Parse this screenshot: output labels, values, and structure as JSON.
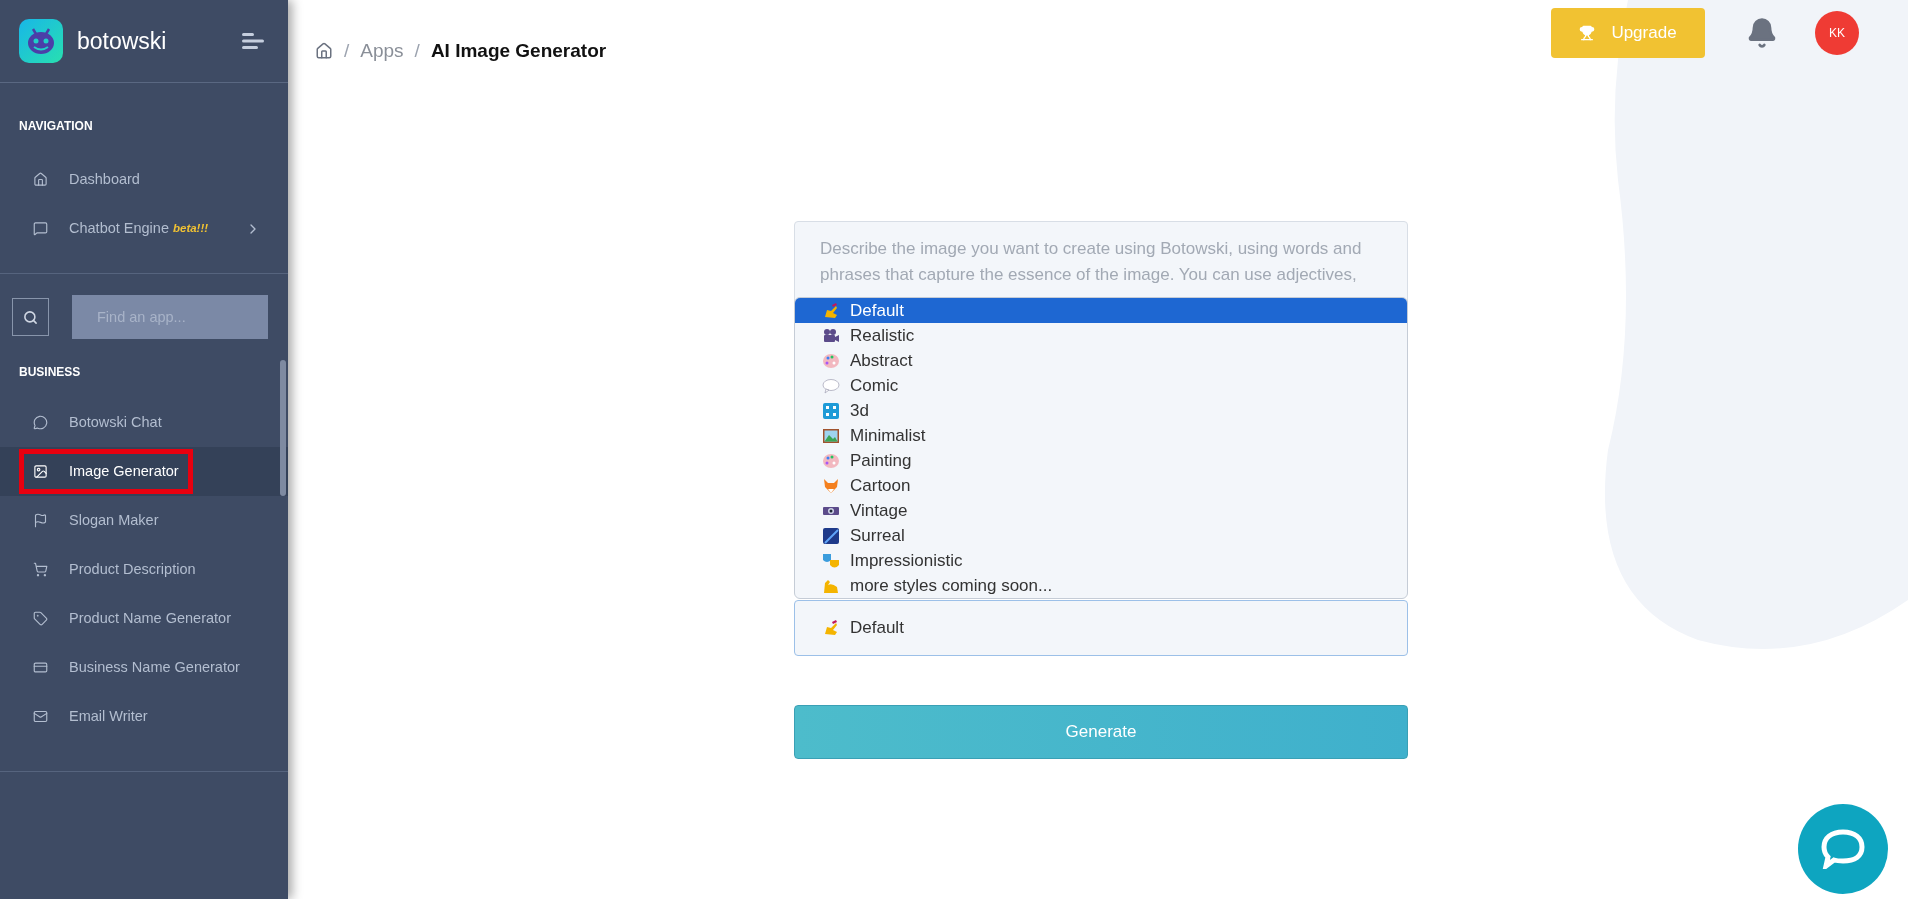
{
  "brand": {
    "name": "botowski"
  },
  "sidebar": {
    "sections": [
      {
        "title": "NAVIGATION",
        "items": [
          {
            "label": "Dashboard",
            "selected": false
          },
          {
            "label": "Chatbot Engine",
            "badge": "beta!!!",
            "submenu": true,
            "selected": false
          }
        ]
      },
      {
        "title": "BUSINESS",
        "items": [
          {
            "label": "Botowski Chat",
            "selected": false
          },
          {
            "label": "Image Generator",
            "selected": true,
            "highlighted": true
          },
          {
            "label": "Slogan Maker",
            "selected": false
          },
          {
            "label": "Product Description",
            "selected": false
          },
          {
            "label": "Product Name Generator",
            "selected": false
          },
          {
            "label": "Business Name Generator",
            "selected": false
          },
          {
            "label": "Email Writer",
            "selected": false
          }
        ]
      }
    ],
    "search": {
      "placeholder": "Find an app..."
    }
  },
  "breadcrumb": {
    "separator": "/",
    "items": [
      "Apps",
      "AI Image Generator"
    ]
  },
  "header": {
    "upgrade": "Upgrade",
    "avatar": "KK"
  },
  "form": {
    "prompt_placeholder": "Describe the image you want to create using Botowski, using words and phrases that capture the essence of the image. You can use adjectives,",
    "style_options": [
      {
        "label": "Default",
        "selected": true
      },
      {
        "label": "Realistic",
        "selected": false
      },
      {
        "label": "Abstract",
        "selected": false
      },
      {
        "label": "Comic",
        "selected": false
      },
      {
        "label": "3d",
        "selected": false
      },
      {
        "label": "Minimalist",
        "selected": false
      },
      {
        "label": "Painting",
        "selected": false
      },
      {
        "label": "Cartoon",
        "selected": false
      },
      {
        "label": "Vintage",
        "selected": false
      },
      {
        "label": "Surreal",
        "selected": false
      },
      {
        "label": "Impressionistic",
        "selected": false
      },
      {
        "label": "more styles coming soon...",
        "selected": false
      }
    ],
    "style_value": "Default",
    "generate": "Generate"
  }
}
